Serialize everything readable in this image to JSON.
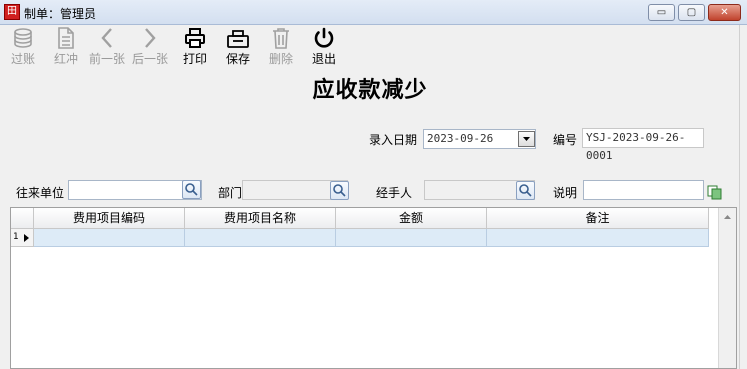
{
  "window": {
    "title": "制单：管理员",
    "minimize_symbol": "▭",
    "maximize_symbol": "▢",
    "close_symbol": "✕"
  },
  "toolbar": {
    "items": [
      {
        "label": "过账",
        "icon": "coins-icon",
        "enabled": false
      },
      {
        "label": "红冲",
        "icon": "document-icon",
        "enabled": false
      },
      {
        "label": "前一张",
        "icon": "chevron-left-icon",
        "enabled": false
      },
      {
        "label": "后一张",
        "icon": "chevron-right-icon",
        "enabled": false
      },
      {
        "label": "打印",
        "icon": "printer-icon",
        "enabled": true
      },
      {
        "label": "保存",
        "icon": "save-tray-icon",
        "enabled": true
      },
      {
        "label": "删除",
        "icon": "trash-icon",
        "enabled": false
      },
      {
        "label": "退出",
        "icon": "power-icon",
        "enabled": true
      }
    ]
  },
  "form": {
    "title": "应收款减少",
    "entry_date_label": "录入日期",
    "entry_date_value": "2023-09-26",
    "number_label": "编号",
    "number_value": "YSJ-2023-09-26-0001",
    "partner_label": "往来单位",
    "partner_value": "",
    "department_label": "部门",
    "department_value": "",
    "handler_label": "经手人",
    "handler_value": "",
    "note_label": "说明",
    "note_value": ""
  },
  "grid": {
    "columns": [
      "费用项目编码",
      "费用项目名称",
      "金额",
      "备注"
    ],
    "rows": [
      {
        "index": "1",
        "cells": [
          "",
          "",
          "",
          ""
        ]
      }
    ]
  },
  "colors": {
    "title_bar": "#d3dff0",
    "selected_row": "#ddebf7",
    "close_button": "#c0432d"
  }
}
